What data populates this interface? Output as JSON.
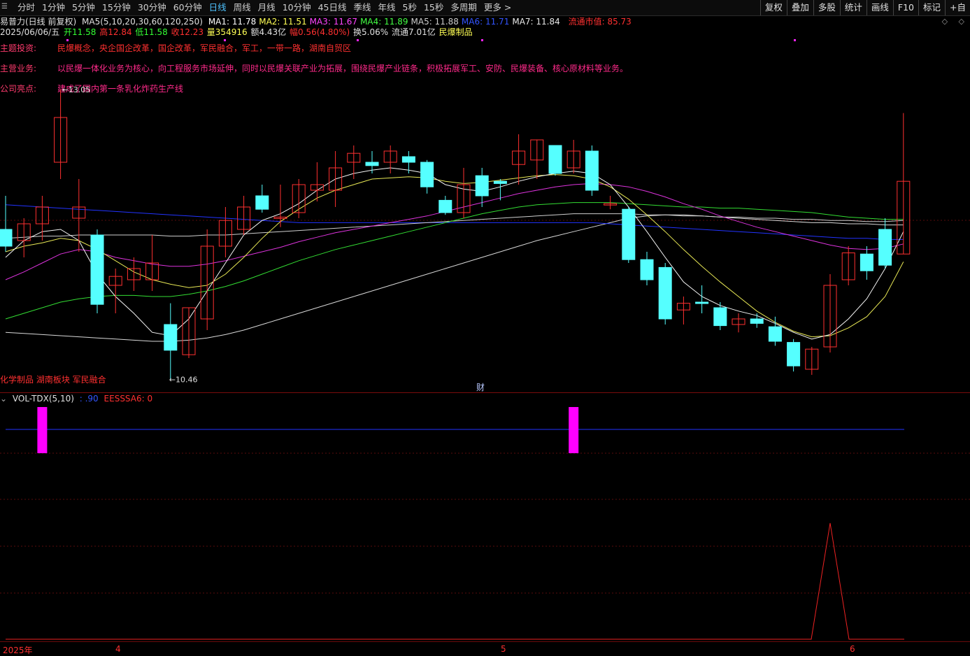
{
  "toolbar": {
    "periods": [
      "分时",
      "1分钟",
      "5分钟",
      "15分钟",
      "30分钟",
      "60分钟",
      "日线",
      "周线",
      "月线",
      "10分钟",
      "45日线",
      "季线",
      "年线",
      "5秒",
      "15秒",
      "多周期",
      "更多 >"
    ],
    "active_index": 6,
    "tools": [
      "复权",
      "叠加",
      "多股",
      "统计",
      "画线",
      "F10",
      "标记",
      "+自"
    ]
  },
  "header": {
    "stock_title": "易普力(日线 前复权)",
    "ma_params": "MA5(5,10,20,30,60,120,250)",
    "ma_values": [
      {
        "label": "MA1: 11.78",
        "color": "#ffffff"
      },
      {
        "label": "MA2: 11.51",
        "color": "#ffff55"
      },
      {
        "label": "MA3: 11.67",
        "color": "#ff44ff"
      },
      {
        "label": "MA4: 11.89",
        "color": "#44ff44"
      },
      {
        "label": "MA5: 11.88",
        "color": "#cccccc"
      },
      {
        "label": "MA6: 11.71",
        "color": "#3355ff"
      },
      {
        "label": "MA7: 11.84",
        "color": "#e8e8e8"
      }
    ],
    "float_mktcap": "流通市值: 85.73",
    "date": "2025/06/06/五",
    "open": "开11.58",
    "high": "高12.84",
    "low": "低11.58",
    "close": "收12.23",
    "volume": "量354916",
    "amount": "额4.43亿",
    "change": "幅0.56(4.80%)",
    "turnover": "换5.06%",
    "float_cap": "流通7.01亿",
    "sector": "民爆制品",
    "nav_arrows": "◇ ◇"
  },
  "info": {
    "theme_label": "主题投资:",
    "theme_value": "民爆概念，央企国企改革，国企改革，军民融合，军工，一带一路，湖南自贸区",
    "business_label": "主营业务:",
    "business_value": "以民爆一体化业务为核心，向工程服务市场延伸，同时以民爆关联产业为拓展，围绕民爆产业链条，积极拓展军工、安防、民爆装备、核心原材料等业务。",
    "highlight_label": "公司亮点:",
    "highlight_value": "建成了国内第一条乳化炸药生产线"
  },
  "chart_annotations": {
    "high_marker": "13.05",
    "low_marker": "10.46",
    "tags": "化学制品 湖南板块 军民融合",
    "fin_marker": "财"
  },
  "volume_panel": {
    "title": "VOL-TDX(5,10)",
    "value1": ": .90",
    "value2": "EESSSA6: 0"
  },
  "date_axis": {
    "labels": [
      "2025年",
      "4",
      "5",
      "6"
    ]
  },
  "colors": {
    "up": "#ff3030",
    "down": "#55ffff",
    "active_period": "#4fc3ff",
    "event_bar": "#ff00ff",
    "blue_line": "#2233ff"
  },
  "chart_data": {
    "type": "candlestick",
    "candles": [
      {
        "o": 11.8,
        "h": 12.1,
        "l": 11.6,
        "c": 11.65
      },
      {
        "o": 11.7,
        "h": 11.9,
        "l": 11.55,
        "c": 11.85
      },
      {
        "o": 11.85,
        "h": 12.1,
        "l": 11.7,
        "c": 12.0
      },
      {
        "o": 12.4,
        "h": 13.05,
        "l": 12.25,
        "c": 12.8
      },
      {
        "o": 11.9,
        "h": 12.25,
        "l": 11.6,
        "c": 12.0
      },
      {
        "o": 11.75,
        "h": 11.8,
        "l": 11.05,
        "c": 11.13
      },
      {
        "o": 11.3,
        "h": 11.45,
        "l": 11.05,
        "c": 11.38
      },
      {
        "o": 11.35,
        "h": 11.55,
        "l": 11.25,
        "c": 11.45
      },
      {
        "o": 11.35,
        "h": 11.75,
        "l": 11.25,
        "c": 11.5
      },
      {
        "o": 10.95,
        "h": 11.14,
        "l": 10.46,
        "c": 10.72
      },
      {
        "o": 10.68,
        "h": 11.1,
        "l": 10.65,
        "c": 11.1
      },
      {
        "o": 11.0,
        "h": 11.8,
        "l": 10.9,
        "c": 11.65
      },
      {
        "o": 11.65,
        "h": 12.0,
        "l": 11.55,
        "c": 11.88
      },
      {
        "o": 11.8,
        "h": 12.1,
        "l": 11.75,
        "c": 12.0
      },
      {
        "o": 12.1,
        "h": 12.2,
        "l": 11.95,
        "c": 11.98
      },
      {
        "o": 11.91,
        "h": 12.2,
        "l": 11.82,
        "c": 11.91
      },
      {
        "o": 11.95,
        "h": 12.25,
        "l": 11.9,
        "c": 12.2
      },
      {
        "o": 12.15,
        "h": 12.4,
        "l": 12.05,
        "c": 12.2
      },
      {
        "o": 12.15,
        "h": 12.5,
        "l": 12.0,
        "c": 12.35
      },
      {
        "o": 12.4,
        "h": 12.55,
        "l": 12.25,
        "c": 12.48
      },
      {
        "o": 12.4,
        "h": 12.5,
        "l": 12.3,
        "c": 12.37
      },
      {
        "o": 12.4,
        "h": 12.55,
        "l": 12.3,
        "c": 12.5
      },
      {
        "o": 12.45,
        "h": 12.5,
        "l": 12.3,
        "c": 12.4
      },
      {
        "o": 12.4,
        "h": 12.42,
        "l": 12.12,
        "c": 12.18
      },
      {
        "o": 12.06,
        "h": 12.1,
        "l": 11.93,
        "c": 11.95
      },
      {
        "o": 11.95,
        "h": 12.35,
        "l": 11.9,
        "c": 12.2
      },
      {
        "o": 12.28,
        "h": 12.35,
        "l": 12.0,
        "c": 12.1
      },
      {
        "o": 12.23,
        "h": 12.25,
        "l": 12.06,
        "c": 12.21
      },
      {
        "o": 12.38,
        "h": 12.65,
        "l": 12.2,
        "c": 12.5
      },
      {
        "o": 12.42,
        "h": 12.6,
        "l": 12.25,
        "c": 12.6
      },
      {
        "o": 12.55,
        "h": 12.55,
        "l": 12.28,
        "c": 12.3
      },
      {
        "o": 12.35,
        "h": 12.6,
        "l": 12.3,
        "c": 12.5
      },
      {
        "o": 12.5,
        "h": 12.55,
        "l": 12.1,
        "c": 12.15
      },
      {
        "o": 12.02,
        "h": 12.1,
        "l": 11.98,
        "c": 12.03
      },
      {
        "o": 11.98,
        "h": 12.0,
        "l": 11.5,
        "c": 11.53
      },
      {
        "o": 11.53,
        "h": 11.6,
        "l": 11.3,
        "c": 11.35
      },
      {
        "o": 11.46,
        "h": 11.5,
        "l": 10.95,
        "c": 11.0
      },
      {
        "o": 11.08,
        "h": 11.2,
        "l": 10.95,
        "c": 11.14
      },
      {
        "o": 11.15,
        "h": 11.3,
        "l": 11.05,
        "c": 11.14
      },
      {
        "o": 11.1,
        "h": 11.15,
        "l": 10.9,
        "c": 10.94
      },
      {
        "o": 10.95,
        "h": 11.05,
        "l": 10.88,
        "c": 11.0
      },
      {
        "o": 11.0,
        "h": 11.05,
        "l": 10.92,
        "c": 10.96
      },
      {
        "o": 10.93,
        "h": 11.02,
        "l": 10.76,
        "c": 10.8
      },
      {
        "o": 10.79,
        "h": 10.82,
        "l": 10.53,
        "c": 10.58
      },
      {
        "o": 10.55,
        "h": 10.75,
        "l": 10.5,
        "c": 10.73
      },
      {
        "o": 10.75,
        "h": 11.4,
        "l": 10.7,
        "c": 11.3
      },
      {
        "o": 11.35,
        "h": 11.65,
        "l": 11.3,
        "c": 11.59
      },
      {
        "o": 11.58,
        "h": 11.65,
        "l": 11.35,
        "c": 11.43
      },
      {
        "o": 11.8,
        "h": 11.9,
        "l": 11.45,
        "c": 11.48
      },
      {
        "o": 11.58,
        "h": 12.84,
        "l": 11.58,
        "c": 12.23
      }
    ],
    "ma1": [
      11.55,
      11.7,
      11.78,
      11.8,
      11.7,
      11.4,
      11.2,
      11.05,
      10.88,
      10.85,
      11.0,
      11.25,
      11.5,
      11.75,
      11.88,
      11.94,
      12.03,
      12.15,
      12.25,
      12.3,
      12.33,
      12.35,
      12.33,
      12.3,
      12.2,
      12.16,
      12.14,
      12.18,
      12.23,
      12.27,
      12.3,
      12.32,
      12.3,
      12.2,
      12.0,
      11.78,
      11.55,
      11.33,
      11.2,
      11.12,
      11.07,
      11.03,
      10.96,
      10.88,
      10.82,
      10.86,
      11.0,
      11.18,
      11.45,
      11.78
    ],
    "ma2": [
      11.6,
      11.65,
      11.68,
      11.72,
      11.7,
      11.62,
      11.52,
      11.42,
      11.35,
      11.31,
      11.28,
      11.3,
      11.4,
      11.55,
      11.72,
      11.87,
      11.98,
      12.08,
      12.15,
      12.2,
      12.25,
      12.26,
      12.27,
      12.26,
      12.23,
      12.21,
      12.22,
      12.24,
      12.26,
      12.28,
      12.29,
      12.28,
      12.25,
      12.18,
      12.07,
      11.93,
      11.78,
      11.62,
      11.47,
      11.33,
      11.2,
      11.07,
      10.97,
      10.89,
      10.84,
      10.85,
      10.92,
      11.02,
      11.2,
      11.51
    ],
    "ma3": [
      11.35,
      11.42,
      11.5,
      11.58,
      11.62,
      11.6,
      11.55,
      11.52,
      11.49,
      11.47,
      11.47,
      11.49,
      11.52,
      11.56,
      11.6,
      11.64,
      11.69,
      11.73,
      11.77,
      11.8,
      11.83,
      11.86,
      11.89,
      11.92,
      11.96,
      12.0,
      12.04,
      12.08,
      12.12,
      12.15,
      12.18,
      12.2,
      12.21,
      12.2,
      12.18,
      12.14,
      12.09,
      12.03,
      11.98,
      11.92,
      11.87,
      11.82,
      11.78,
      11.74,
      11.7,
      11.66,
      11.63,
      11.62,
      11.63,
      11.67
    ],
    "ma4": [
      11.0,
      11.05,
      11.1,
      11.15,
      11.18,
      11.2,
      11.21,
      11.21,
      11.2,
      11.2,
      11.22,
      11.25,
      11.29,
      11.34,
      11.4,
      11.46,
      11.52,
      11.57,
      11.62,
      11.66,
      11.7,
      11.74,
      11.78,
      11.82,
      11.86,
      11.9,
      11.94,
      11.97,
      12.0,
      12.02,
      12.03,
      12.04,
      12.04,
      12.04,
      12.03,
      12.02,
      12.01,
      12.0,
      12.0,
      11.99,
      11.99,
      11.98,
      11.97,
      11.96,
      11.95,
      11.93,
      11.91,
      11.9,
      11.89,
      11.89
    ],
    "ma5": [
      11.72,
      11.73,
      11.74,
      11.74,
      11.75,
      11.75,
      11.75,
      11.75,
      11.75,
      11.74,
      11.74,
      11.75,
      11.75,
      11.76,
      11.77,
      11.78,
      11.79,
      11.8,
      11.81,
      11.82,
      11.83,
      11.84,
      11.85,
      11.86,
      11.87,
      11.88,
      11.89,
      11.9,
      11.91,
      11.92,
      11.93,
      11.94,
      11.94,
      11.94,
      11.94,
      11.93,
      11.93,
      11.92,
      11.92,
      11.91,
      11.91,
      11.9,
      11.9,
      11.89,
      11.89,
      11.88,
      11.88,
      11.87,
      11.87,
      11.88
    ],
    "ma6": [
      12.02,
      12.01,
      12.0,
      11.99,
      11.98,
      11.97,
      11.96,
      11.95,
      11.94,
      11.93,
      11.92,
      11.91,
      11.9,
      11.89,
      11.88,
      11.87,
      11.86,
      11.86,
      11.86,
      11.86,
      11.86,
      11.86,
      11.86,
      11.86,
      11.86,
      11.86,
      11.86,
      11.86,
      11.86,
      11.86,
      11.86,
      11.86,
      11.86,
      11.85,
      11.84,
      11.83,
      11.82,
      11.81,
      11.8,
      11.79,
      11.78,
      11.77,
      11.76,
      11.75,
      11.74,
      11.73,
      11.72,
      11.72,
      11.71,
      11.71
    ],
    "ma7": [
      10.88,
      10.87,
      10.86,
      10.85,
      10.84,
      10.83,
      10.82,
      10.81,
      10.8,
      10.8,
      10.81,
      10.83,
      10.86,
      10.9,
      10.95,
      11.0,
      11.05,
      11.1,
      11.15,
      11.2,
      11.25,
      11.3,
      11.35,
      11.4,
      11.45,
      11.5,
      11.55,
      11.6,
      11.65,
      11.7,
      11.74,
      11.78,
      11.82,
      11.86,
      11.9,
      11.92,
      11.93,
      11.93,
      11.92,
      11.91,
      11.9,
      11.89,
      11.88,
      11.87,
      11.86,
      11.86,
      11.85,
      11.85,
      11.84,
      11.84
    ],
    "ylim": [
      10.35,
      13.35
    ],
    "event_bars": [
      2,
      31
    ],
    "indicator_spike_index": 45,
    "indicator_spike_value": 1
  }
}
